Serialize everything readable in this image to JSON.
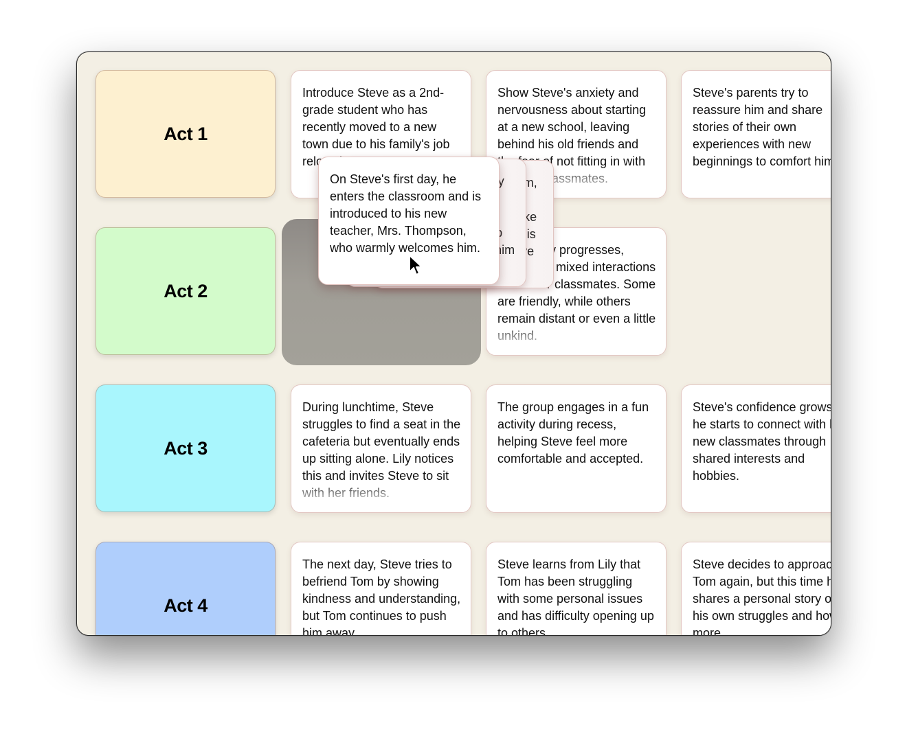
{
  "board": {
    "acts": [
      {
        "label": "Act 1",
        "color": "#fdf0d0"
      },
      {
        "label": "Act 2",
        "color": "#d3fbcb"
      },
      {
        "label": "Act 3",
        "color": "#a9f6fd"
      },
      {
        "label": "Act 4",
        "color": "#afcefc"
      }
    ],
    "rows": [
      {
        "cards": [
          "Introduce Steve as a 2nd-grade student who has recently moved to a new town due to his family's job relocation.",
          "Show Steve's anxiety and nervousness about starting at a new school, leaving behind his old friends and the fear of not fitting in with his new classmates.",
          "Steve's parents try to reassure him and share stories of their own experiences with new beginnings to comfort him."
        ]
      },
      {
        "cards": [
          "As the day progresses, Steve has mixed interactions with other classmates. Some are friendly, while others remain distant or even a little unkind."
        ]
      },
      {
        "cards": [
          "During lunchtime, Steve struggles to find a seat in the cafeteria but eventually ends up sitting alone. Lily notices this and invites Steve to sit with her friends.",
          "The group engages in a fun activity during recess, helping Steve feel more comfortable and accepted.",
          "Steve's confidence grows as he starts to connect with his new classmates through shared interests and hobbies."
        ]
      },
      {
        "cards": [
          "The next day, Steve tries to befriend Tom by showing kindness and understanding, but Tom continues to push him away.",
          "Steve learns from Lily that Tom has been struggling with some personal issues and has difficulty opening up to others.",
          "Steve decides to approach Tom again, but this time he shares a personal story of his own struggles and how more"
        ]
      }
    ],
    "dragging": {
      "card": "On Steve's first day, he enters the classroom and is introduced to his new teacher, Mrs. Thompson, who warmly welcomes him.",
      "stacked_ghosts": [
        "Steve meets Lily, a friendly classmate who is seated next to him. She offers to show him around and help him fit in, and introduces him to others.",
        "Steve also encounters Tom, a classmate who seems unfriendly and tries to make Steve feel unwelcome. This sets up a conflict to resolve later in the story."
      ]
    }
  }
}
